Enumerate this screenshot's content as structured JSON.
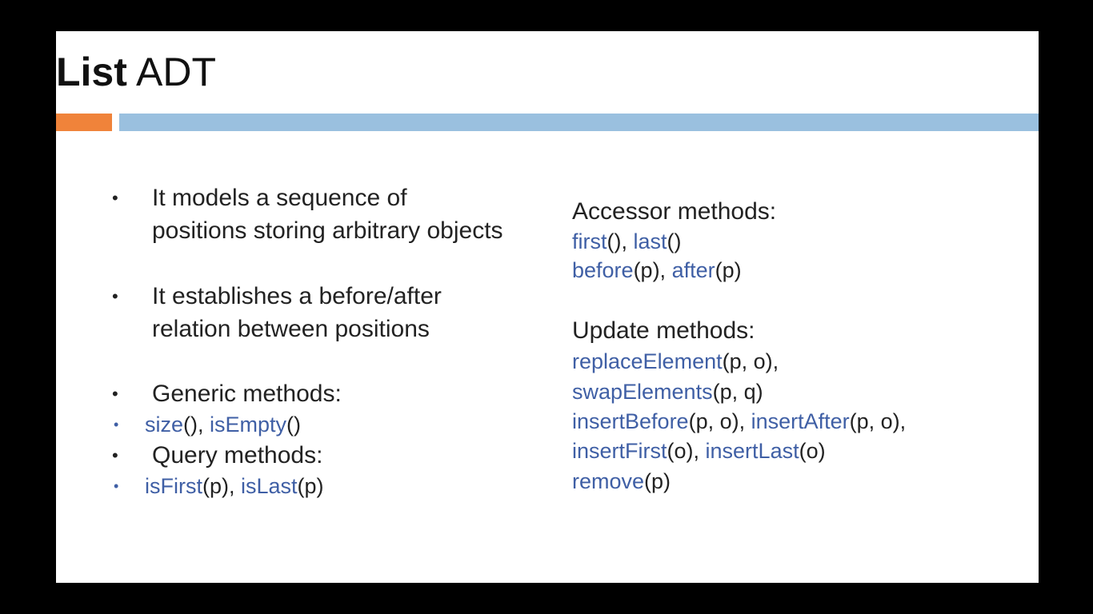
{
  "title": {
    "bold_part": "List",
    "rest": " ADT"
  },
  "colors": {
    "accent_orange": "#f0833a",
    "accent_blue": "#9ac0df",
    "method_blue": "#3f5fa5"
  },
  "left": {
    "bullet_1": {
      "line1": "It models a sequence of",
      "line2": "positions storing arbitrary objects"
    },
    "bullet_2": {
      "line1": "It establishes a before/after",
      "line2": "relation between positions"
    },
    "generic": {
      "label": "Generic methods:",
      "m1": "size",
      "a1": "(), ",
      "m2": "isEmpty",
      "a2": "()"
    },
    "query": {
      "label": "Query methods:",
      "m1": "isFirst",
      "a1": "(p), ",
      "m2": "isLast",
      "a2": "(p)"
    }
  },
  "right": {
    "accessor": {
      "label": "Accessor methods:",
      "l1_m1": "first",
      "l1_a1": "(), ",
      "l1_m2": "last",
      "l1_a2": "()",
      "l2_m1": "before",
      "l2_a1": "(p), ",
      "l2_m2": "after",
      "l2_a2": "(p)"
    },
    "update": {
      "label": "Update methods:",
      "l1_m1": "replaceElement",
      "l1_a1": "(p, o),",
      "l2_m1": "swapElements",
      "l2_a1": "(p, q)",
      "l3_m1": "insertBefore",
      "l3_a1": "(p, o), ",
      "l3_m2": "insertAfter",
      "l3_a2": "(p, o),",
      "l4_m1": "insertFirst",
      "l4_a1": "(o), ",
      "l4_m2": "insertLast",
      "l4_a2": "(o)",
      "l5_m1": "remove",
      "l5_a1": "(p)"
    }
  }
}
